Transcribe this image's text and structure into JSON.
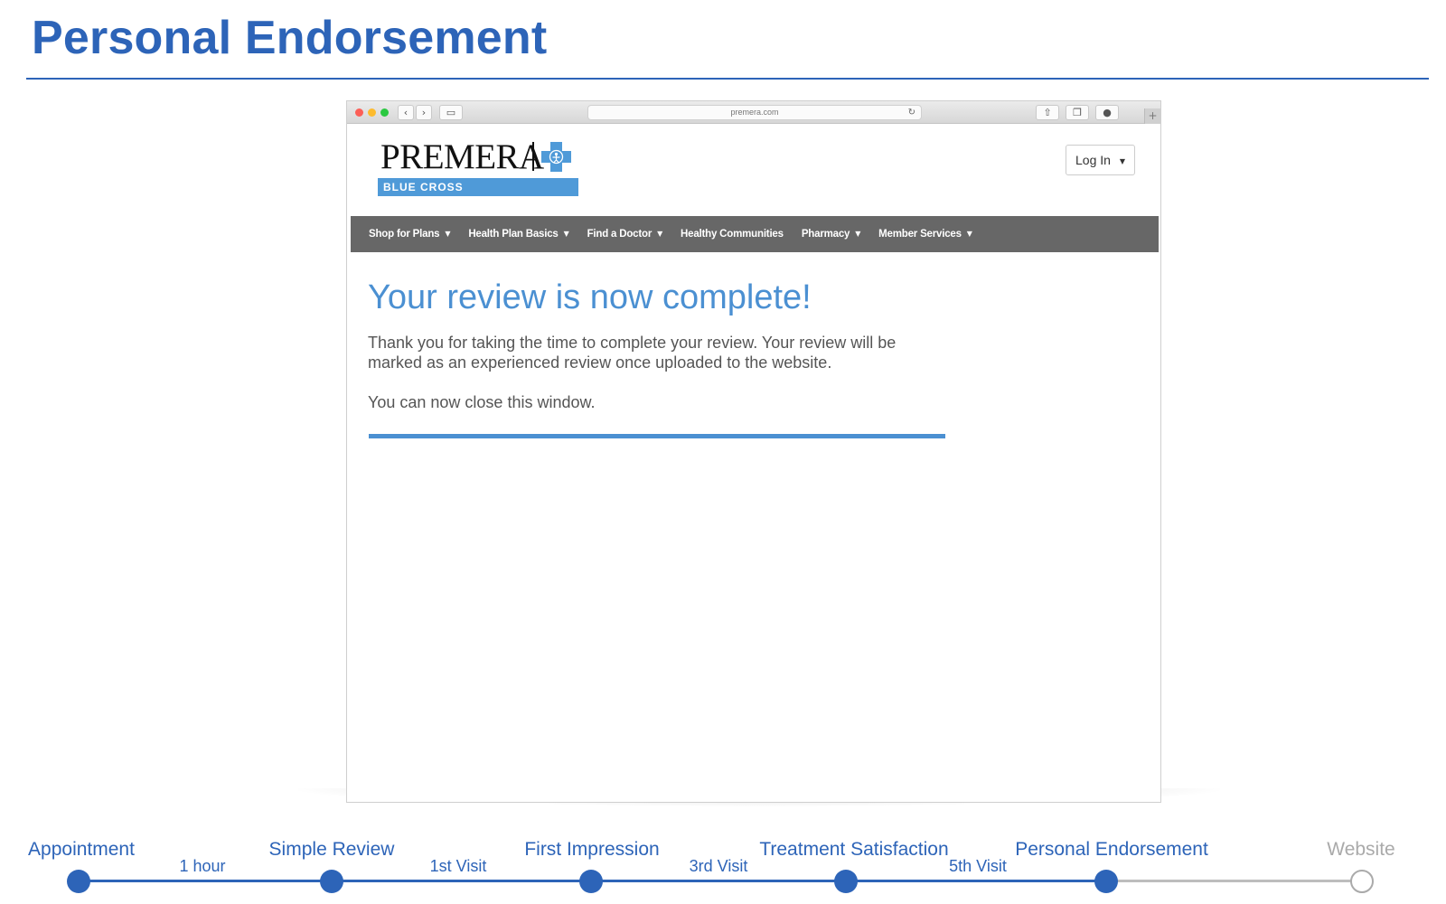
{
  "slide": {
    "title": "Personal Endorsement"
  },
  "browser": {
    "url": "premera.com",
    "nav_back_icon": "chevron-left-icon",
    "nav_forward_icon": "chevron-right-icon"
  },
  "site": {
    "logo_word": "PREMERA",
    "logo_tagline": "BLUE CROSS",
    "login_label": "Log In",
    "nav": [
      {
        "label": "Shop for Plans",
        "has_menu": true
      },
      {
        "label": "Health Plan Basics",
        "has_menu": true
      },
      {
        "label": "Find a Doctor",
        "has_menu": true
      },
      {
        "label": "Healthy Communities",
        "has_menu": false
      },
      {
        "label": "Pharmacy",
        "has_menu": true
      },
      {
        "label": "Member Services",
        "has_menu": true
      }
    ]
  },
  "content": {
    "heading": "Your review is now complete!",
    "body": "Thank you for taking the time to complete your review. Your review will be marked as an experienced review once uploaded to the website.",
    "close_note": "You can now close this window."
  },
  "timeline": {
    "steps": [
      {
        "label": "Appointment",
        "status": "done"
      },
      {
        "label": "Simple Review",
        "status": "done"
      },
      {
        "label": "First Impression",
        "status": "done"
      },
      {
        "label": "Treatment Satisfaction",
        "status": "done"
      },
      {
        "label": "Personal Endorsement",
        "status": "current"
      },
      {
        "label": "Website",
        "status": "upcoming"
      }
    ],
    "gaps": [
      "1 hour",
      "1st Visit",
      "3rd Visit",
      "5th Visit"
    ]
  },
  "colors": {
    "accent": "#2d64b8",
    "site_blue": "#4b90d2",
    "nav_gray": "#676767",
    "inactive": "#aaaaaa"
  }
}
